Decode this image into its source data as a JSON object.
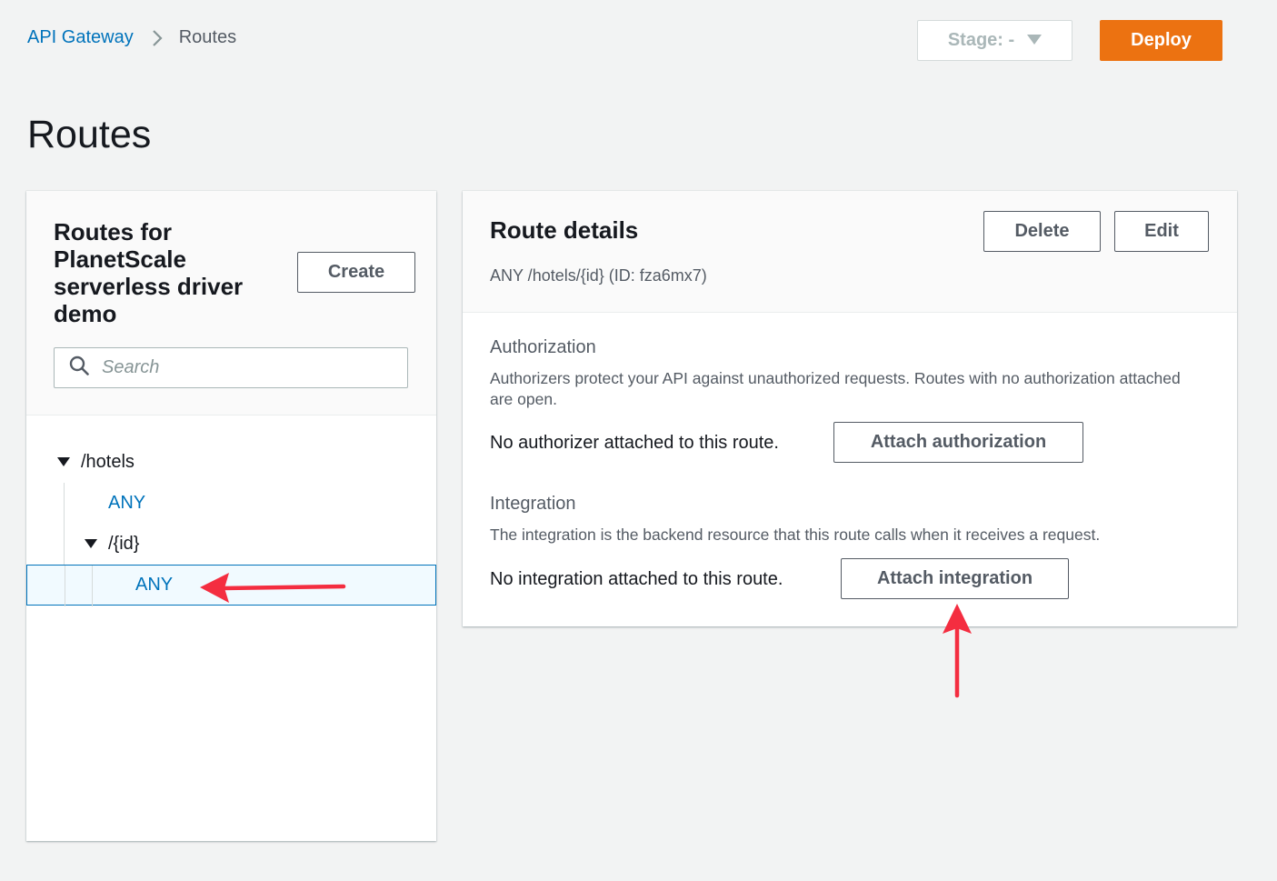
{
  "breadcrumb": {
    "root": "API Gateway",
    "current": "Routes"
  },
  "top_bar": {
    "stage_label": "Stage: -",
    "deploy_label": "Deploy"
  },
  "page_title": "Routes",
  "routes_panel": {
    "title": "Routes for PlanetScale serverless driver demo",
    "create_label": "Create",
    "search_placeholder": "Search",
    "tree": {
      "root_path": "/hotels",
      "root_method": "ANY",
      "child_path": "/{id}",
      "child_method": "ANY"
    }
  },
  "route_details": {
    "title": "Route details",
    "subtitle": "ANY /hotels/{id} (ID: fza6mx7)",
    "delete_label": "Delete",
    "edit_label": "Edit",
    "authorization": {
      "title": "Authorization",
      "description": "Authorizers protect your API against unauthorized requests. Routes with no authorization attached are open.",
      "status": "No authorizer attached to this route.",
      "button_label": "Attach authorization"
    },
    "integration": {
      "title": "Integration",
      "description": "The integration is the backend resource that this route calls when it receives a request.",
      "status": "No integration attached to this route.",
      "button_label": "Attach integration"
    }
  },
  "colors": {
    "link": "#0073bb",
    "deploy": "#ec7211",
    "annotation_arrow": "#f42d40"
  },
  "icons": [
    "chevron-right-icon",
    "caret-down-icon",
    "search-icon",
    "caret-expanded-icon"
  ]
}
